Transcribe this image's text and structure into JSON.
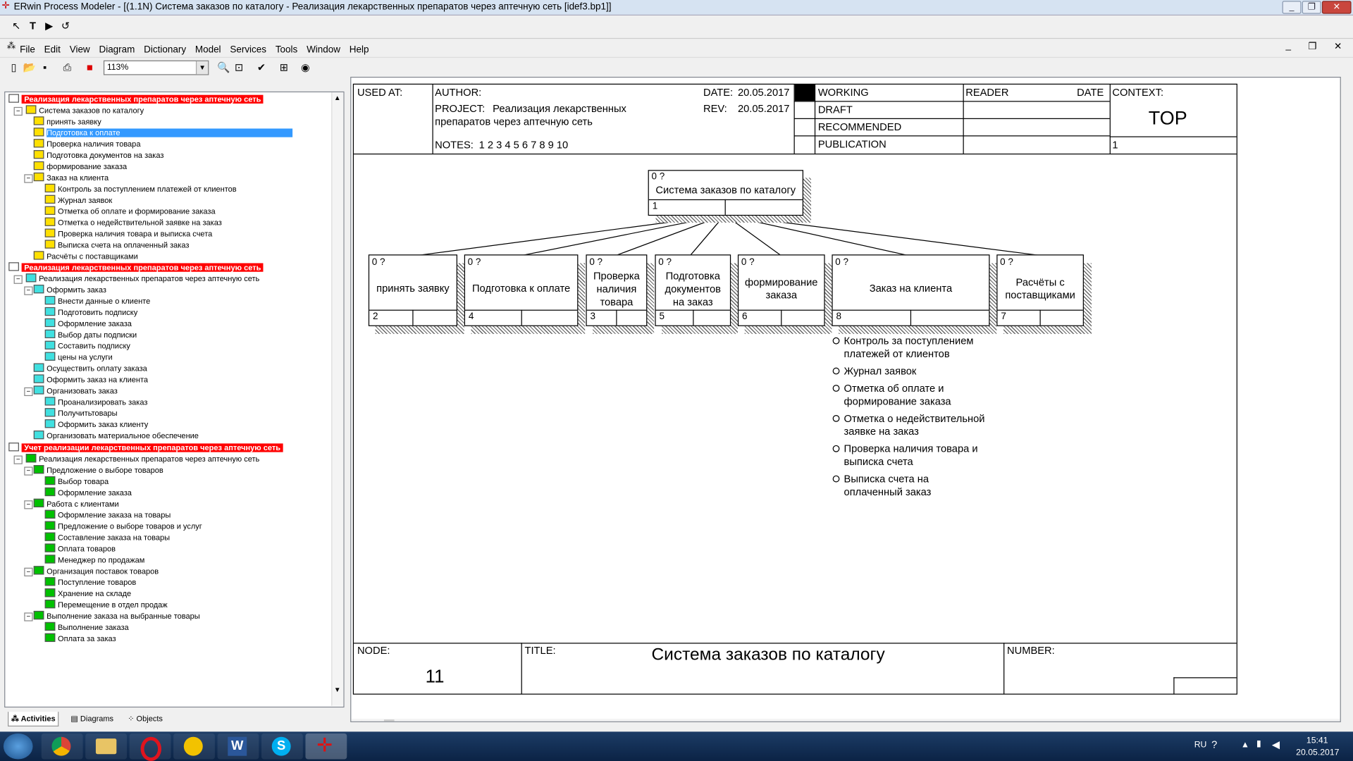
{
  "window": {
    "title": "ERwin Process Modeler - [(1.1N) Система заказов по каталогу - Реализация лекарственных препаратов через аптечную сеть  [idef3.bp1]]"
  },
  "menu": [
    "File",
    "Edit",
    "View",
    "Diagram",
    "Dictionary",
    "Model",
    "Services",
    "Tools",
    "Window",
    "Help"
  ],
  "zoom": "113%",
  "tree": {
    "headers": [
      "Реализация лекарственных препаратов через аптечную сеть",
      "Реализация лекарственных препаратов через аптечную сеть",
      "Учет реализации лекарственных препаратов через аптечную сеть"
    ],
    "items": [
      "Система заказов по каталогу",
      "принять заявку",
      "Подготовка к оплате",
      "Проверка наличия товара",
      "Подготовка  документов  на заказ",
      "формирование заказа",
      "Заказ на клиента",
      "Контроль за поступлением  платежей от клиентов",
      "Журнал заявок",
      "Отметка об оплате и  формирование заказа",
      "Отметка о недействительной  заявке на заказ",
      "Проверка наличия товара и выписка счета",
      "Выписка счета  на оплаченный заказ",
      "Расчёты с поставщиками",
      "Реализация  лекарственных препаратов  через аптечную сеть",
      "Оформить  заказ",
      "Внести данные  о клиенте",
      "Подготовить подписку",
      "Оформление заказа",
      "Выбор даты  подписки",
      "Составить подписку",
      "цены на услуги",
      "Осуществить оплату заказа",
      "Оформить заказ на клиента",
      "Организовать заказ",
      "Проанализировать заказ",
      "Получитьтовары",
      "Оформить заказ клиенту",
      "Организовать материальное обеспечение",
      "Реализация  лекарственных препаратов  через аптечную сеть",
      "Предложение о выборе товаров",
      "Выбор товара",
      "Оформление заказа",
      "Работа с клиентами",
      "Оформление  заказа на товары",
      "Предложение о выборе  товаров и услуг",
      "Составление заказа  на товары",
      "Оплата товаров",
      "Менеджер по продажам",
      "Организация поставок товаров",
      "Поступление товаров",
      "Хранение на складе",
      "Перемещение в  отдел продаж",
      "Выполнение заказа  на выбранные товары",
      "Выполнение заказа",
      "Оплата за заказ"
    ]
  },
  "tabs": [
    "Activities",
    "Diagrams",
    "Objects"
  ],
  "frame": {
    "used_at": "USED AT:",
    "author": "AUTHOR:",
    "project_label": "PROJECT:",
    "project_line1": "Реализация лекарственных",
    "project_line2": "препаратов через аптечную сеть",
    "date_label": "DATE:",
    "date": "20.05.2017",
    "rev_label": "REV:",
    "rev": "20.05.2017",
    "notes_label": "NOTES:",
    "notes": "1  2  3  4  5  6  7  8  9  10",
    "working": "WORKING",
    "draft": "DRAFT",
    "recommended": "RECOMMENDED",
    "publication": "PUBLICATION",
    "reader": "READER",
    "reader_date": "DATE",
    "context": "CONTEXT:",
    "context_value": "TOP",
    "context_num": "1",
    "node_label": "NODE:",
    "node": "11",
    "title_label": "TITLE:",
    "title": "Система заказов по каталогу",
    "number_label": "NUMBER:"
  },
  "diagram": {
    "parent": {
      "cost": "0 ?",
      "name": "Система заказов по каталогу",
      "num": "1"
    },
    "children": [
      {
        "cost": "0 ?",
        "name1": "принять заявку",
        "name2": "",
        "name3": "",
        "num": "2"
      },
      {
        "cost": "0 ?",
        "name1": "Подготовка к оплате",
        "name2": "",
        "name3": "",
        "num": "4"
      },
      {
        "cost": "0 ?",
        "name1": "Проверка",
        "name2": "наличия",
        "name3": "товара",
        "num": "3"
      },
      {
        "cost": "0 ?",
        "name1": "Подготовка",
        "name2": "документов",
        "name3": "на заказ",
        "num": "5"
      },
      {
        "cost": "0 ?",
        "name1": "формирование",
        "name2": "заказа",
        "name3": "",
        "num": "6"
      },
      {
        "cost": "0 ?",
        "name1": "Заказ на клиента",
        "name2": "",
        "name3": "",
        "num": "8"
      },
      {
        "cost": "0 ?",
        "name1": "Расчёты с",
        "name2": "поставщиками",
        "name3": "",
        "num": "7"
      }
    ],
    "notes": [
      {
        "l1": "Контроль за поступлением",
        "l2": "платежей от клиентов"
      },
      {
        "l1": "Журнал заявок",
        "l2": ""
      },
      {
        "l1": "Отметка об оплате и",
        "l2": "формирование заказа"
      },
      {
        "l1": "Отметка о недействительной",
        "l2": "заявке на заказ"
      },
      {
        "l1": "Проверка наличия товара и",
        "l2": "выписка счета"
      },
      {
        "l1": "Выписка счета  на",
        "l2": "оплаченный заказ"
      }
    ]
  },
  "tray": {
    "lang": "RU",
    "time": "15:41",
    "date": "20.05.2017"
  }
}
